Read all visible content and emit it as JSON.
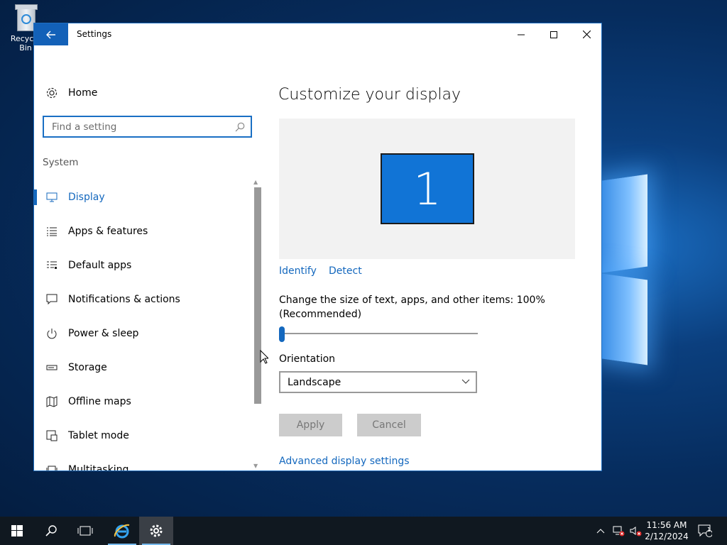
{
  "desktop": {
    "recycle_bin_label": "Recycle Bin"
  },
  "window": {
    "title": "Settings",
    "controls": {
      "minimize": "minimize-icon",
      "maximize": "maximize-icon",
      "close": "close-icon"
    }
  },
  "sidebar": {
    "home_label": "Home",
    "search_placeholder": "Find a setting",
    "section_label": "System",
    "items": [
      {
        "label": "Display",
        "icon": "monitor-icon",
        "active": true
      },
      {
        "label": "Apps & features",
        "icon": "list-icon"
      },
      {
        "label": "Default apps",
        "icon": "default-apps-icon"
      },
      {
        "label": "Notifications & actions",
        "icon": "message-icon"
      },
      {
        "label": "Power & sleep",
        "icon": "power-icon"
      },
      {
        "label": "Storage",
        "icon": "storage-icon"
      },
      {
        "label": "Offline maps",
        "icon": "map-icon"
      },
      {
        "label": "Tablet mode",
        "icon": "tablet-icon"
      },
      {
        "label": "Multitasking",
        "icon": "multitasking-icon"
      }
    ]
  },
  "content": {
    "heading": "Customize your display",
    "monitor_number": "1",
    "identify_link": "Identify",
    "detect_link": "Detect",
    "scale_label": "Change the size of text, apps, and other items: 100% (Recommended)",
    "scale_slider_value": 0,
    "orientation_label": "Orientation",
    "orientation_value": "Landscape",
    "apply_label": "Apply",
    "cancel_label": "Cancel",
    "advanced_link": "Advanced display settings"
  },
  "taskbar": {
    "time": "11:56 AM",
    "date": "2/12/2024",
    "notification_count": "1"
  },
  "colors": {
    "accent": "#1468be",
    "monitor_fill": "#1174d6",
    "taskbar": "#101820"
  }
}
